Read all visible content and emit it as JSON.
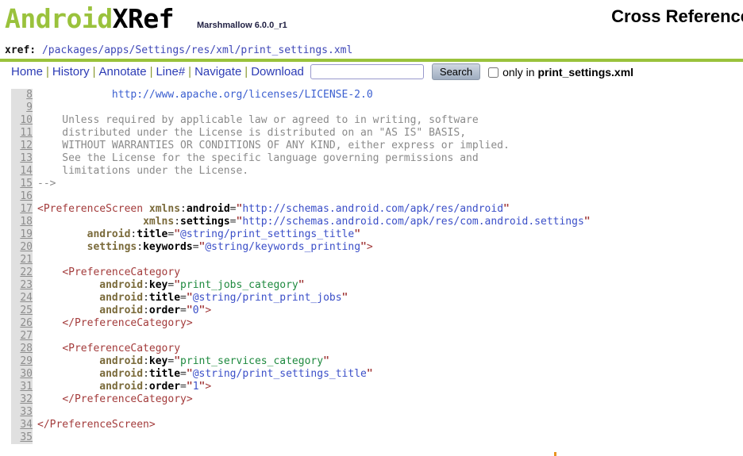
{
  "header": {
    "logo_android": "Android",
    "logo_xref": "XRef",
    "version": "Marshmallow 6.0.0_r1",
    "cross_reference_title": "Cross Reference"
  },
  "xref_bar": {
    "label": "xref:",
    "path": " /packages/apps/Settings/res/xml/print_settings.xml"
  },
  "menu": {
    "links": [
      "Home",
      "History",
      "Annotate",
      "Line#",
      "Navigate",
      "Download"
    ],
    "separator": "|",
    "search_value": "",
    "search_placeholder": "",
    "search_button_label": "Search",
    "only_in_prefix": "only in ",
    "only_in_filename": "print_settings.xml",
    "only_in_checked": false
  },
  "colors": {
    "brand_green": "#9ac23c",
    "link_blue": "#2c3bb5",
    "tag_red": "#a33b3b",
    "string_blue": "#3b4fc8",
    "string_green": "#1f8a3f",
    "comment_gray": "#8a8a8a",
    "gutter_gray": "#e0e0e0"
  },
  "code": {
    "first_line": 8,
    "last_line": 35,
    "lines": [
      {
        "n": 8,
        "tokens": [
          {
            "c": "t-comment",
            "t": "            "
          },
          {
            "c": "t-link",
            "t": "http://www.apache.org/licenses/LICENSE-2.0"
          }
        ]
      },
      {
        "n": 9,
        "tokens": []
      },
      {
        "n": 10,
        "tokens": [
          {
            "c": "t-comment",
            "t": "    Unless required by applicable law or agreed to in writing, software"
          }
        ]
      },
      {
        "n": 11,
        "tokens": [
          {
            "c": "t-comment",
            "t": "    distributed under the License is distributed on an \"AS IS\" BASIS,"
          }
        ]
      },
      {
        "n": 12,
        "tokens": [
          {
            "c": "t-comment",
            "t": "    WITHOUT WARRANTIES OR CONDITIONS OF ANY KIND, either express or implied."
          }
        ]
      },
      {
        "n": 13,
        "tokens": [
          {
            "c": "t-comment",
            "t": "    See the License for the specific language governing permissions and"
          }
        ]
      },
      {
        "n": 14,
        "tokens": [
          {
            "c": "t-comment",
            "t": "    limitations under the License."
          }
        ]
      },
      {
        "n": 15,
        "tokens": [
          {
            "c": "t-comment",
            "t": "-->"
          }
        ]
      },
      {
        "n": 16,
        "tokens": []
      },
      {
        "n": 17,
        "tokens": [
          {
            "c": "t-punct",
            "t": "<"
          },
          {
            "c": "t-tag",
            "t": "PreferenceScreen"
          },
          {
            "c": "t-plain",
            "t": " "
          },
          {
            "c": "t-ns",
            "t": "xmlns"
          },
          {
            "c": "t-eq",
            "t": ":"
          },
          {
            "c": "t-attr",
            "t": "android"
          },
          {
            "c": "t-eq",
            "t": "="
          },
          {
            "c": "t-quote",
            "t": "\""
          },
          {
            "c": "t-strblue",
            "t": "http://schemas.android.com/apk/res/android"
          },
          {
            "c": "t-quote",
            "t": "\""
          }
        ]
      },
      {
        "n": 18,
        "tokens": [
          {
            "c": "t-plain",
            "t": "                 "
          },
          {
            "c": "t-ns",
            "t": "xmlns"
          },
          {
            "c": "t-eq",
            "t": ":"
          },
          {
            "c": "t-attr",
            "t": "settings"
          },
          {
            "c": "t-eq",
            "t": "="
          },
          {
            "c": "t-quote",
            "t": "\""
          },
          {
            "c": "t-strblue",
            "t": "http://schemas.android.com/apk/res/com.android.settings"
          },
          {
            "c": "t-quote",
            "t": "\""
          }
        ]
      },
      {
        "n": 19,
        "tokens": [
          {
            "c": "t-plain",
            "t": "        "
          },
          {
            "c": "t-ns",
            "t": "android"
          },
          {
            "c": "t-eq",
            "t": ":"
          },
          {
            "c": "t-attr",
            "t": "title"
          },
          {
            "c": "t-eq",
            "t": "="
          },
          {
            "c": "t-quote",
            "t": "\""
          },
          {
            "c": "t-strblue",
            "t": "@string/print_settings_title"
          },
          {
            "c": "t-quote",
            "t": "\""
          }
        ]
      },
      {
        "n": 20,
        "tokens": [
          {
            "c": "t-plain",
            "t": "        "
          },
          {
            "c": "t-ns",
            "t": "settings"
          },
          {
            "c": "t-eq",
            "t": ":"
          },
          {
            "c": "t-attr",
            "t": "keywords"
          },
          {
            "c": "t-eq",
            "t": "="
          },
          {
            "c": "t-quote",
            "t": "\""
          },
          {
            "c": "t-strblue",
            "t": "@string/keywords_printing"
          },
          {
            "c": "t-quote",
            "t": "\""
          },
          {
            "c": "t-punct",
            "t": ">"
          }
        ]
      },
      {
        "n": 21,
        "tokens": []
      },
      {
        "n": 22,
        "tokens": [
          {
            "c": "t-plain",
            "t": "    "
          },
          {
            "c": "t-punct",
            "t": "<"
          },
          {
            "c": "t-tag",
            "t": "PreferenceCategory"
          }
        ]
      },
      {
        "n": 23,
        "tokens": [
          {
            "c": "t-plain",
            "t": "          "
          },
          {
            "c": "t-ns",
            "t": "android"
          },
          {
            "c": "t-eq",
            "t": ":"
          },
          {
            "c": "t-attr",
            "t": "key"
          },
          {
            "c": "t-eq",
            "t": "="
          },
          {
            "c": "t-quote",
            "t": "\""
          },
          {
            "c": "t-strgreen",
            "t": "print_jobs_category"
          },
          {
            "c": "t-quote",
            "t": "\""
          }
        ]
      },
      {
        "n": 24,
        "tokens": [
          {
            "c": "t-plain",
            "t": "          "
          },
          {
            "c": "t-ns",
            "t": "android"
          },
          {
            "c": "t-eq",
            "t": ":"
          },
          {
            "c": "t-attr",
            "t": "title"
          },
          {
            "c": "t-eq",
            "t": "="
          },
          {
            "c": "t-quote",
            "t": "\""
          },
          {
            "c": "t-strblue",
            "t": "@string/print_print_jobs"
          },
          {
            "c": "t-quote",
            "t": "\""
          }
        ]
      },
      {
        "n": 25,
        "tokens": [
          {
            "c": "t-plain",
            "t": "          "
          },
          {
            "c": "t-ns",
            "t": "android"
          },
          {
            "c": "t-eq",
            "t": ":"
          },
          {
            "c": "t-attr",
            "t": "order"
          },
          {
            "c": "t-eq",
            "t": "="
          },
          {
            "c": "t-quote",
            "t": "\""
          },
          {
            "c": "t-strblue",
            "t": "0"
          },
          {
            "c": "t-quote",
            "t": "\""
          },
          {
            "c": "t-punct",
            "t": ">"
          }
        ]
      },
      {
        "n": 26,
        "tokens": [
          {
            "c": "t-plain",
            "t": "    "
          },
          {
            "c": "t-punct",
            "t": "</"
          },
          {
            "c": "t-tag",
            "t": "PreferenceCategory"
          },
          {
            "c": "t-punct",
            "t": ">"
          }
        ]
      },
      {
        "n": 27,
        "tokens": []
      },
      {
        "n": 28,
        "tokens": [
          {
            "c": "t-plain",
            "t": "    "
          },
          {
            "c": "t-punct",
            "t": "<"
          },
          {
            "c": "t-tag",
            "t": "PreferenceCategory"
          }
        ]
      },
      {
        "n": 29,
        "tokens": [
          {
            "c": "t-plain",
            "t": "          "
          },
          {
            "c": "t-ns",
            "t": "android"
          },
          {
            "c": "t-eq",
            "t": ":"
          },
          {
            "c": "t-attr",
            "t": "key"
          },
          {
            "c": "t-eq",
            "t": "="
          },
          {
            "c": "t-quote",
            "t": "\""
          },
          {
            "c": "t-strgreen",
            "t": "print_services_category"
          },
          {
            "c": "t-quote",
            "t": "\""
          }
        ]
      },
      {
        "n": 30,
        "tokens": [
          {
            "c": "t-plain",
            "t": "          "
          },
          {
            "c": "t-ns",
            "t": "android"
          },
          {
            "c": "t-eq",
            "t": ":"
          },
          {
            "c": "t-attr",
            "t": "title"
          },
          {
            "c": "t-eq",
            "t": "="
          },
          {
            "c": "t-quote",
            "t": "\""
          },
          {
            "c": "t-strblue",
            "t": "@string/print_settings_title"
          },
          {
            "c": "t-quote",
            "t": "\""
          }
        ]
      },
      {
        "n": 31,
        "tokens": [
          {
            "c": "t-plain",
            "t": "          "
          },
          {
            "c": "t-ns",
            "t": "android"
          },
          {
            "c": "t-eq",
            "t": ":"
          },
          {
            "c": "t-attr",
            "t": "order"
          },
          {
            "c": "t-eq",
            "t": "="
          },
          {
            "c": "t-quote",
            "t": "\""
          },
          {
            "c": "t-strblue",
            "t": "1"
          },
          {
            "c": "t-quote",
            "t": "\""
          },
          {
            "c": "t-punct",
            "t": ">"
          }
        ]
      },
      {
        "n": 32,
        "tokens": [
          {
            "c": "t-plain",
            "t": "    "
          },
          {
            "c": "t-punct",
            "t": "</"
          },
          {
            "c": "t-tag",
            "t": "PreferenceCategory"
          },
          {
            "c": "t-punct",
            "t": ">"
          }
        ]
      },
      {
        "n": 33,
        "tokens": []
      },
      {
        "n": 34,
        "tokens": [
          {
            "c": "t-punct",
            "t": "</"
          },
          {
            "c": "t-tag",
            "t": "PreferenceScreen"
          },
          {
            "c": "t-punct",
            "t": ">"
          }
        ]
      },
      {
        "n": 35,
        "tokens": []
      }
    ]
  }
}
